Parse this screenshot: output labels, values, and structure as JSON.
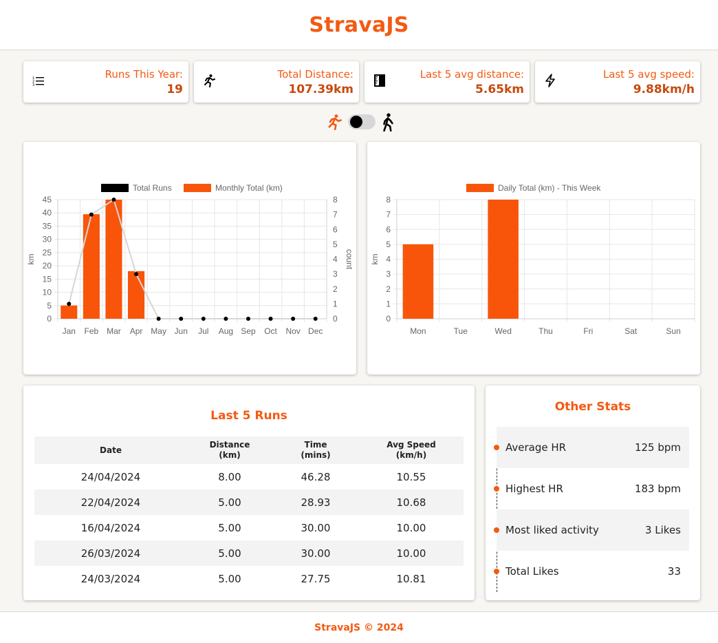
{
  "app": {
    "title": "StravaJS",
    "footer": "StravaJS © 2024"
  },
  "stats": [
    {
      "label": "Runs This Year:",
      "value": "19",
      "icon": "list-icon"
    },
    {
      "label": "Total Distance:",
      "value": "107.39km",
      "icon": "runner-icon"
    },
    {
      "label": "Last 5 avg distance:",
      "value": "5.65km",
      "icon": "ruler-icon"
    },
    {
      "label": "Last 5 avg speed:",
      "value": "9.88km/h",
      "icon": "lightning-icon"
    }
  ],
  "toggle": {
    "left_icon": "runner-icon",
    "right_icon": "walker-icon",
    "state": "run"
  },
  "colors": {
    "accent": "#f35a12",
    "bar": "#f8550b",
    "line_point": "#000000",
    "line": "#d6d6d6"
  },
  "chart_data": [
    {
      "type": "bar",
      "categories": [
        "Jan",
        "Feb",
        "Mar",
        "Apr",
        "May",
        "Jun",
        "Jul",
        "Aug",
        "Sep",
        "Oct",
        "Nov",
        "Dec"
      ],
      "series": [
        {
          "name": "Total Runs",
          "type": "line",
          "axis": "right",
          "values": [
            1,
            7,
            8,
            3,
            0,
            0,
            0,
            0,
            0,
            0,
            0,
            0
          ]
        },
        {
          "name": "Monthly Total (km)",
          "type": "bar",
          "axis": "left",
          "values": [
            5,
            39.5,
            45,
            18,
            0,
            0,
            0,
            0,
            0,
            0,
            0,
            0
          ]
        }
      ],
      "ylabel": "km",
      "y2label": "count",
      "ylim": [
        0,
        45
      ],
      "y2lim": [
        0,
        8
      ],
      "yticks": [
        "0",
        "5",
        "10",
        "15",
        "20",
        "25",
        "30",
        "35",
        "40",
        "45"
      ],
      "y2ticks": [
        "0",
        "1",
        "2",
        "3",
        "4",
        "5",
        "6",
        "7",
        "8"
      ],
      "legend": "top",
      "grid": true
    },
    {
      "type": "bar",
      "categories": [
        "Mon",
        "Tue",
        "Wed",
        "Thu",
        "Fri",
        "Sat",
        "Sun"
      ],
      "series": [
        {
          "name": "Daily Total (km) - This Week",
          "values": [
            5,
            0,
            8,
            0,
            0,
            0,
            0
          ]
        }
      ],
      "ylabel": "km",
      "ylim": [
        0,
        8
      ],
      "yticks": [
        "0",
        "1",
        "2",
        "3",
        "4",
        "5",
        "6",
        "7",
        "8"
      ],
      "legend": "top",
      "grid": true
    }
  ],
  "runs": {
    "title": "Last 5 Runs",
    "headers": [
      [
        "Date"
      ],
      [
        "Distance",
        "(km)"
      ],
      [
        "Time",
        "(mins)"
      ],
      [
        "Avg Speed",
        "(km/h)"
      ]
    ],
    "rows": [
      [
        "24/04/2024",
        "8.00",
        "46.28",
        "10.55"
      ],
      [
        "22/04/2024",
        "5.00",
        "28.93",
        "10.68"
      ],
      [
        "16/04/2024",
        "5.00",
        "30.00",
        "10.00"
      ],
      [
        "26/03/2024",
        "5.00",
        "30.00",
        "10.00"
      ],
      [
        "24/03/2024",
        "5.00",
        "27.75",
        "10.81"
      ]
    ]
  },
  "other": {
    "title": "Other Stats",
    "items": [
      {
        "label": "Average HR",
        "value": "125 bpm"
      },
      {
        "label": "Highest HR",
        "value": "183 bpm"
      },
      {
        "label": "Most liked activity",
        "value": "3 Likes"
      },
      {
        "label": "Total Likes",
        "value": "33"
      }
    ]
  }
}
